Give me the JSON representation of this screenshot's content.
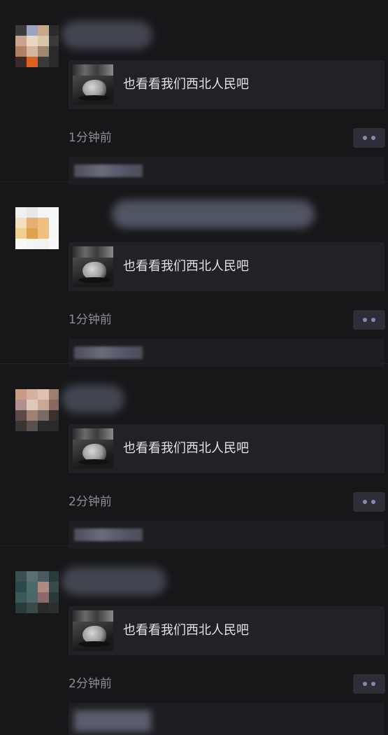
{
  "posts": [
    {
      "shared_text": "也看看我们西北人民吧",
      "time": "1分钟前",
      "avatar_colors": [
        "#3a3a3a",
        "#9aa3c0",
        "#c6a88c",
        "#2a2a2a",
        "#c8a48e",
        "#e8d6c2",
        "#d8c6a8",
        "#3a3a3a",
        "#b08060",
        "#d4b6a0",
        "#a08870",
        "#2a2a2a",
        "#3a2a2a",
        "#e06020",
        "#3a3a3a",
        "#2a2a2a"
      ]
    },
    {
      "shared_text": "也看看我们西北人民吧",
      "time": "1分钟前",
      "avatar_colors": [
        "#f0f0f0",
        "#e8e8e8",
        "#f4f4f4",
        "#f6f6f6",
        "#f0e0c0",
        "#e8b070",
        "#f0c080",
        "#f8f8f8",
        "#f0d090",
        "#e0a050",
        "#eec080",
        "#f6f6f6",
        "#f8f8f8",
        "#f4f4f4",
        "#f2f2f2",
        "#f8f8f8"
      ]
    },
    {
      "shared_text": "也看看我们西北人民吧",
      "time": "2分钟前",
      "avatar_colors": [
        "#c89a88",
        "#d8b0a0",
        "#e0c0b0",
        "#a08070",
        "#b09090",
        "#e0c8b8",
        "#c8a898",
        "#8a6a60",
        "#5a4a4a",
        "#a08070",
        "#7a6a66",
        "#3a3030",
        "#3a3434",
        "#5a5050",
        "#2a2a2a",
        "#2a2a2a"
      ]
    },
    {
      "shared_text": "也看看我们西北人民吧",
      "time": "2分钟前",
      "avatar_colors": [
        "#3a5050",
        "#5a7070",
        "#4a5a60",
        "#2a3a3a",
        "#2a4a4a",
        "#4a6a6a",
        "#b08a80",
        "#3a4a4a",
        "#3a5a5a",
        "#4a6868",
        "#8a6a6a",
        "#2a3838",
        "#2a3a3a",
        "#3a4a4a",
        "#2a2a2a",
        "#2a3030"
      ]
    }
  ],
  "colors": {
    "background": "#17171a",
    "card": "#222226",
    "dot": "#7f8db0"
  }
}
